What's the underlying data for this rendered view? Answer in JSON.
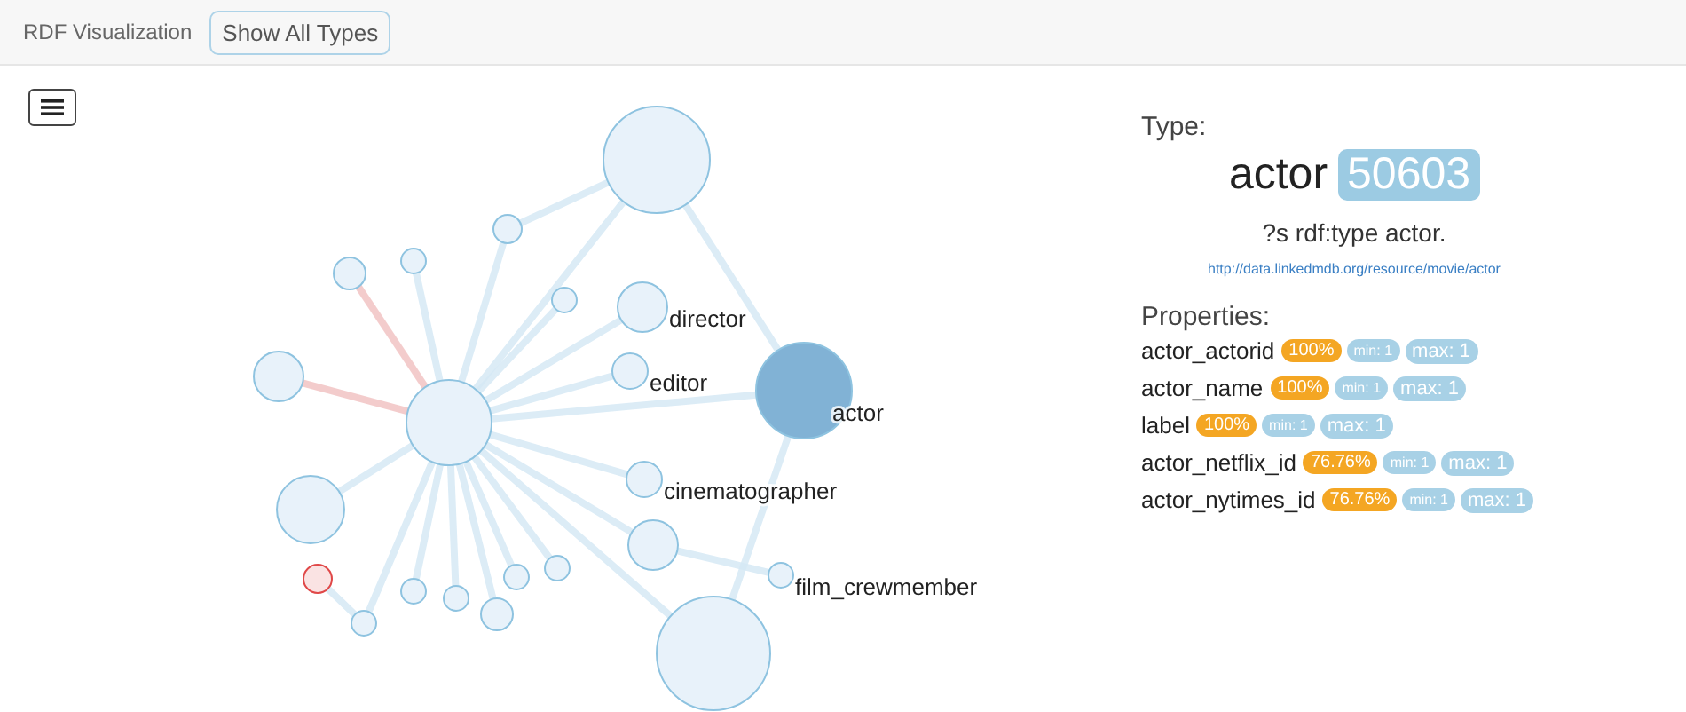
{
  "navbar": {
    "brand": "RDF Visualization",
    "button": "Show All Types"
  },
  "graph": {
    "nodes": [
      {
        "selected": false,
        "color": "#8ec3e0"
      },
      {
        "selected": false,
        "color": "#8ec3e0"
      },
      {
        "selected": false,
        "color": "#8ec3e0"
      },
      {
        "selected": false,
        "color": "#8ec3e0"
      },
      {
        "selected": false,
        "color": "#8ec3e0"
      },
      {
        "label": "director",
        "selected": false,
        "color": "#8ec3e0"
      },
      {
        "label": "editor",
        "selected": false,
        "color": "#8ec3e0"
      },
      {
        "label": "actor",
        "selected": true,
        "color": "#8ec3e0"
      },
      {
        "selected": false,
        "color": "#8ec3e0"
      },
      {
        "selected": false,
        "color": "#8ec3e0"
      },
      {
        "label": "cinematographer",
        "selected": false,
        "color": "#8ec3e0"
      },
      {
        "selected": false,
        "color": "#8ec3e0"
      },
      {
        "selected": false,
        "color": "#8ec3e0"
      },
      {
        "label": "film_crewmember",
        "selected": false,
        "color": "#8ec3e0"
      },
      {
        "selected": false,
        "color": "#e04848"
      },
      {
        "selected": false,
        "color": "#8ec3e0"
      },
      {
        "selected": false,
        "color": "#8ec3e0"
      },
      {
        "selected": false,
        "color": "#8ec3e0"
      },
      {
        "selected": false,
        "color": "#8ec3e0"
      },
      {
        "selected": false,
        "color": "#8ec3e0"
      },
      {
        "selected": false,
        "color": "#8ec3e0"
      },
      {
        "selected": false,
        "color": "#8ec3e0"
      }
    ]
  },
  "type_panel": {
    "heading": "Type:",
    "name": "actor",
    "count": "50603",
    "query": "?s rdf:type actor.",
    "uri": "http://data.linkedmdb.org/resource/movie/actor",
    "properties_heading": "Properties:",
    "properties": [
      {
        "name": "actor_actorid",
        "coverage": "100%",
        "min": "min: 1",
        "max": "max: 1"
      },
      {
        "name": "actor_name",
        "coverage": "100%",
        "min": "min: 1",
        "max": "max: 1"
      },
      {
        "name": "label",
        "coverage": "100%",
        "min": "min: 1",
        "max": "max: 1"
      },
      {
        "name": "actor_netflix_id",
        "coverage": "76.76%",
        "min": "min: 1",
        "max": "max: 1"
      },
      {
        "name": "actor_nytimes_id",
        "coverage": "76.76%",
        "min": "min: 1",
        "max": "max: 1"
      }
    ]
  }
}
